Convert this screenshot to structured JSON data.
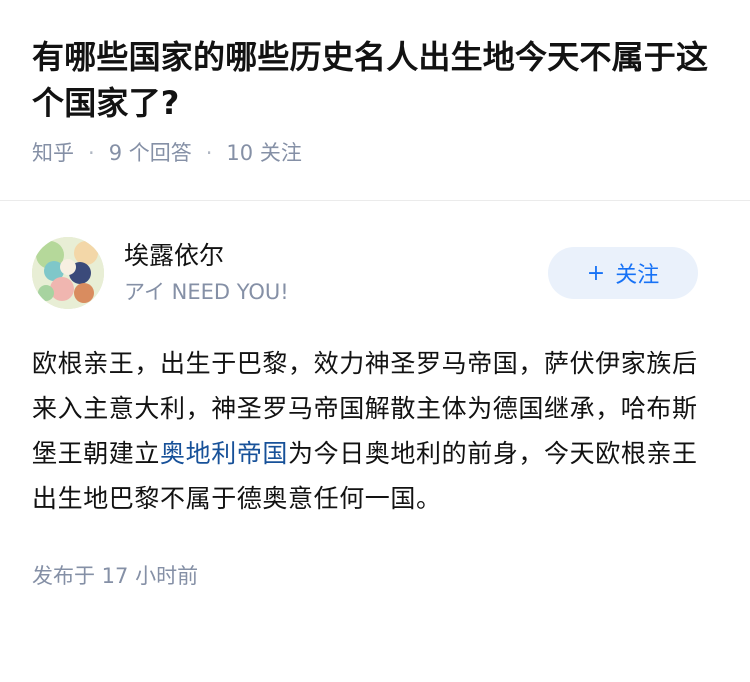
{
  "question": {
    "title": "有哪些国家的哪些历史名人出生地今天不属于这个国家了?",
    "source": "知乎",
    "answers_count": "9 个回答",
    "followers_count": "10 关注"
  },
  "answer": {
    "author": {
      "name": "埃露依尔",
      "headline": "アイ NEED YOU!"
    },
    "follow_button": {
      "icon": "plus-icon",
      "label": "关注"
    },
    "content": {
      "text_before_link": "欧根亲王，出生于巴黎，效力神圣罗马帝国，萨伏伊家族后来入主意大利，神圣罗马帝国解散主体为德国继承，哈布斯堡王朝建立",
      "link_text": "奥地利帝国",
      "text_after_link": "为今日奥地利的前身，今天欧根亲王出生地巴黎不属于德奥意任何一国。"
    },
    "published": "发布于  17 小时前"
  },
  "colors": {
    "accent": "#1772f6",
    "link": "#175199",
    "meta_text": "#8590a6",
    "follow_bg": "#eaf1fb"
  }
}
